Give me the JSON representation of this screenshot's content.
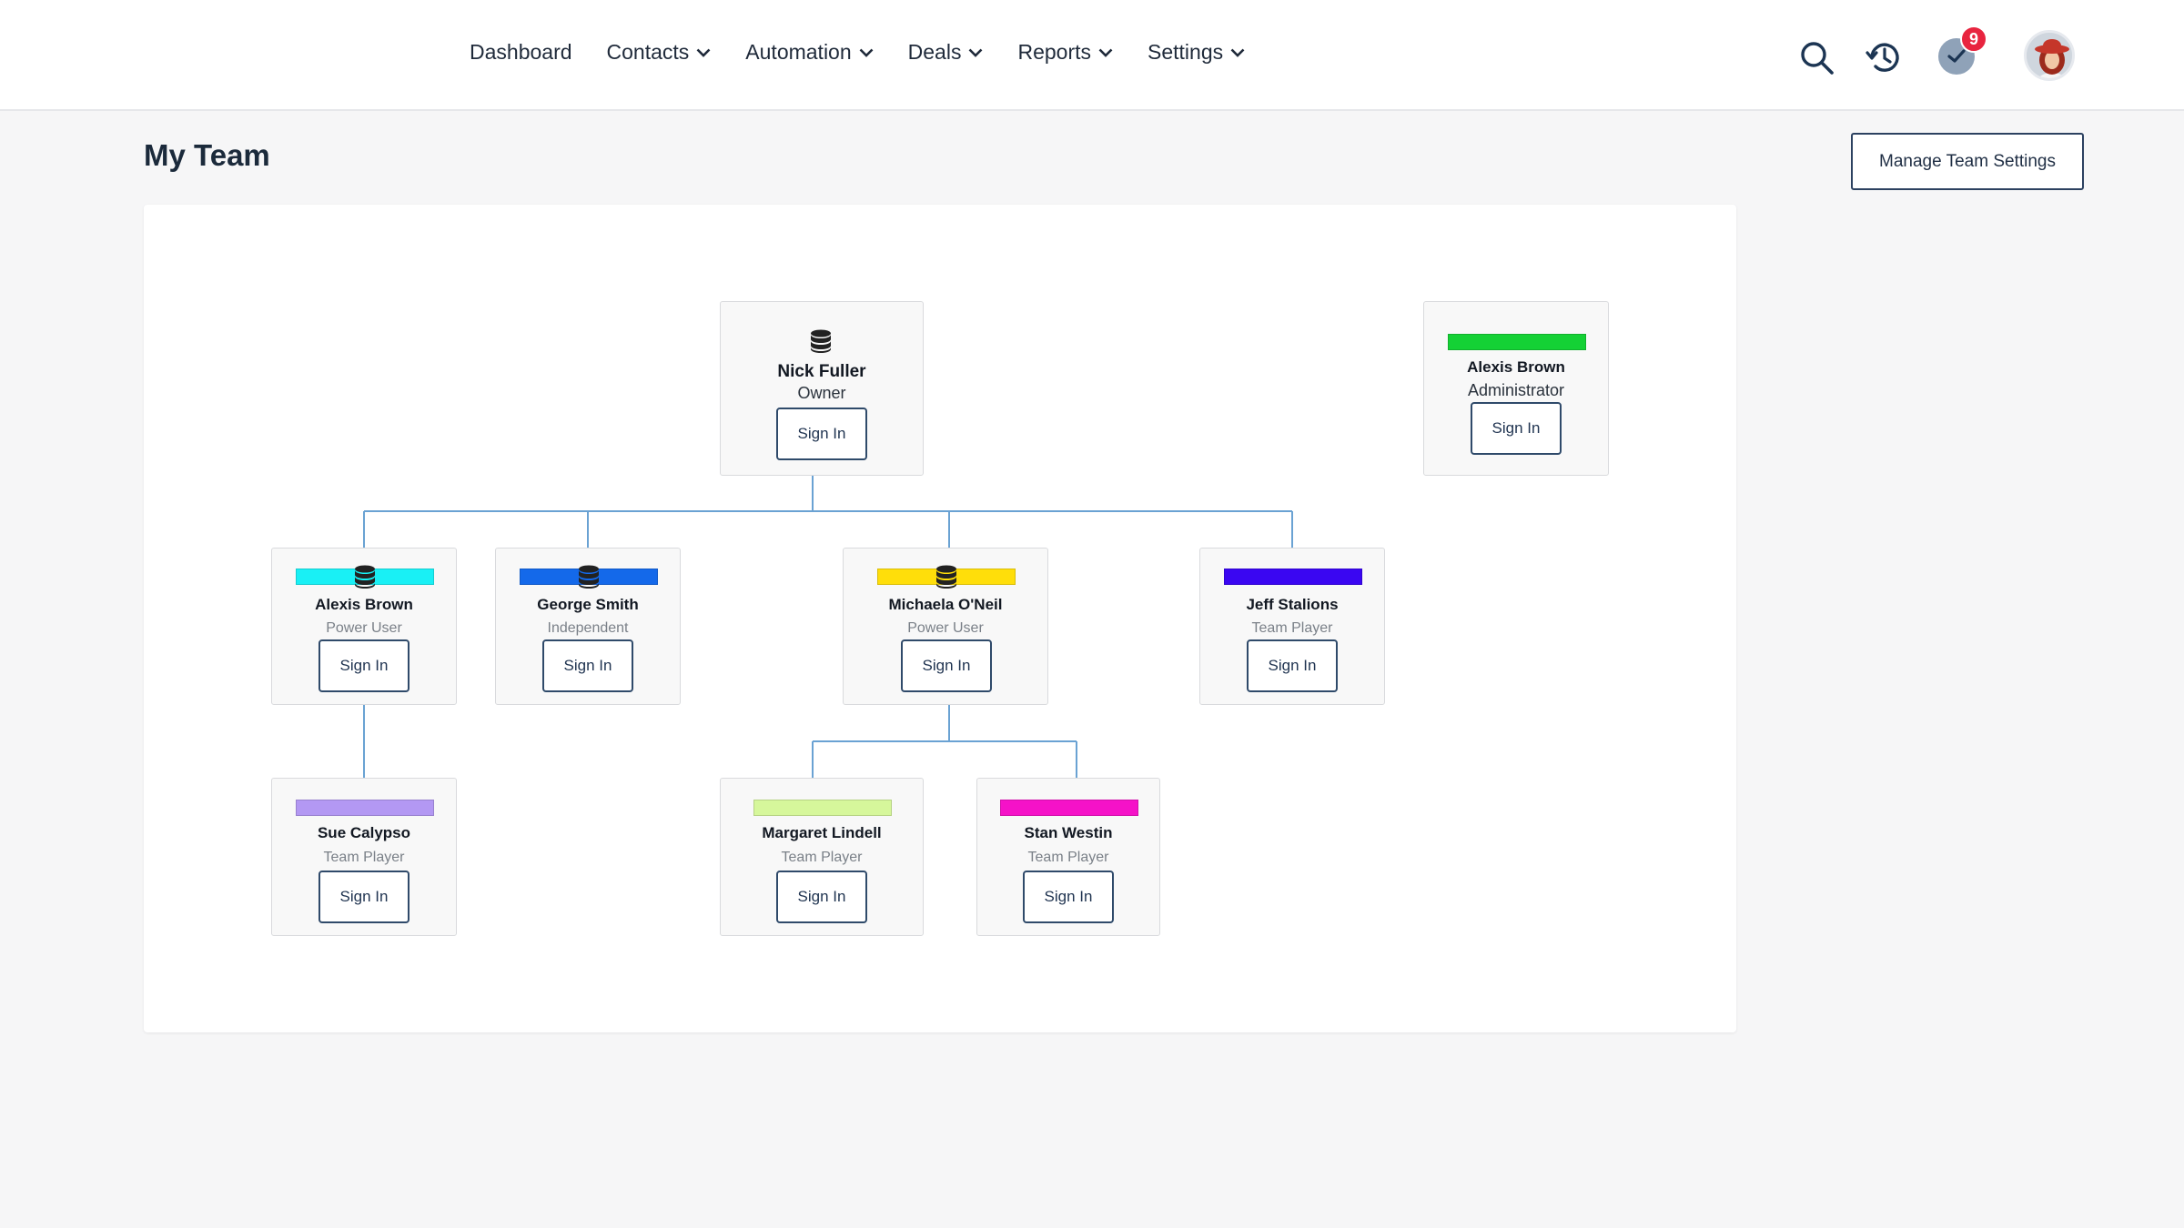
{
  "nav": {
    "items": [
      {
        "label": "Dashboard",
        "dropdown": false
      },
      {
        "label": "Contacts",
        "dropdown": true
      },
      {
        "label": "Automation",
        "dropdown": true
      },
      {
        "label": "Deals",
        "dropdown": true
      },
      {
        "label": "Reports",
        "dropdown": true
      },
      {
        "label": "Settings",
        "dropdown": true
      }
    ]
  },
  "header": {
    "icons": [
      "search-icon",
      "history-icon",
      "tasks-check-icon",
      "user-avatar"
    ],
    "notification_count": "9"
  },
  "page": {
    "title": "My Team",
    "manage_button": "Manage Team Settings"
  },
  "members": {
    "owner": {
      "name": "Nick Fuller",
      "role": "Owner",
      "button": "Sign In",
      "icon": "database-icon"
    },
    "admin": {
      "name": "Alexis Brown",
      "role": "Administrator",
      "button": "Sign In",
      "color": "#14d135"
    },
    "alexis": {
      "name": "Alexis Brown",
      "role": "Power User",
      "button": "Sign In",
      "color": "#19f0f5",
      "icon": "database-icon"
    },
    "george": {
      "name": "George Smith",
      "role": "Independent",
      "button": "Sign In",
      "color": "#1469ea",
      "icon": "database-icon"
    },
    "michaela": {
      "name": "Michaela O'Neil",
      "role": "Power User",
      "button": "Sign In",
      "color": "#ffde0a",
      "icon": "database-icon"
    },
    "jeff": {
      "name": "Jeff Stalions",
      "role": "Team Player",
      "button": "Sign In",
      "color": "#3a06f2"
    },
    "sue": {
      "name": "Sue Calypso",
      "role": "Team Player",
      "button": "Sign In",
      "color": "#b398f3"
    },
    "margaret": {
      "name": "Margaret Lindell",
      "role": "Team Player",
      "button": "Sign In",
      "color": "#d6f79b"
    },
    "stan": {
      "name": "Stan Westin",
      "role": "Team Player",
      "button": "Sign In",
      "color": "#f512c8"
    }
  },
  "colors": {
    "accent": "#2c4160",
    "connector": "#6aa2d3",
    "badge": "#e8243f"
  }
}
